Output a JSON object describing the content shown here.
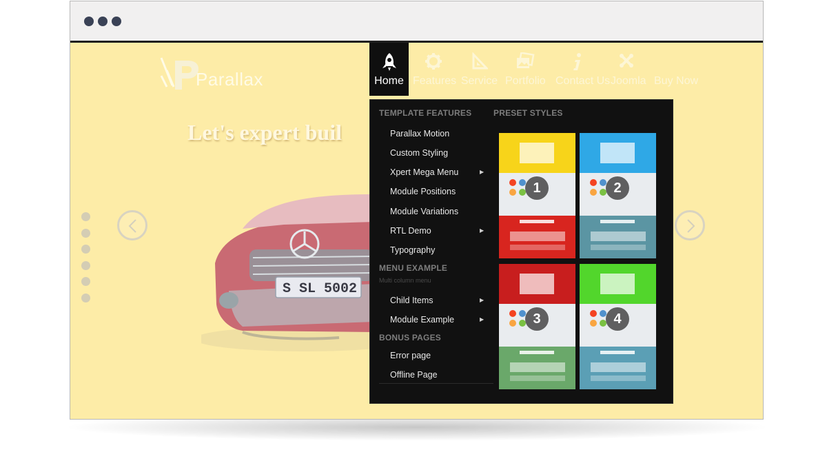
{
  "window": {
    "controls": [
      "dot",
      "dot",
      "dot"
    ]
  },
  "site": {
    "logo_text": "Parallax",
    "hero_headline": "Let's expert buil"
  },
  "nav": [
    {
      "label": "Home",
      "icon": "rocket-icon",
      "active": true
    },
    {
      "label": "Features",
      "icon": "gear-icon",
      "active": false
    },
    {
      "label": "Service",
      "icon": "set-square-icon",
      "active": false
    },
    {
      "label": "Portfolio",
      "icon": "photos-icon",
      "active": false
    },
    {
      "label": "Contact Us",
      "icon": "info-icon",
      "active": false
    },
    {
      "label": "Joomla",
      "icon": "joomla-icon",
      "active": false
    },
    {
      "label": "Buy Now",
      "icon": "",
      "active": false
    }
  ],
  "mega_menu": {
    "template_features": {
      "title": "TEMPLATE FEATURES",
      "items": [
        {
          "label": "Parallax Motion",
          "has_sub": false
        },
        {
          "label": "Custom Styling",
          "has_sub": false
        },
        {
          "label": "Xpert Mega Menu",
          "has_sub": true
        },
        {
          "label": "Module Positions",
          "has_sub": false
        },
        {
          "label": "Module Variations",
          "has_sub": false
        },
        {
          "label": "RTL Demo",
          "has_sub": true
        },
        {
          "label": "Typography",
          "has_sub": false
        }
      ]
    },
    "menu_example": {
      "title": "MENU EXAMPLE",
      "subtitle": "Multi column menu",
      "items": [
        {
          "label": "Child Items",
          "has_sub": true
        },
        {
          "label": "Module Example",
          "has_sub": true
        }
      ]
    },
    "bonus_pages": {
      "title": "BONUS PAGES",
      "items": [
        {
          "label": "Error page"
        },
        {
          "label": "Offline Page"
        }
      ]
    },
    "preset_styles": {
      "title": "PRESET STYLES",
      "presets": [
        {
          "number": "1",
          "top_color": "#f7d41a",
          "bottom_color": "#d8251f"
        },
        {
          "number": "2",
          "top_color": "#2fa8e6",
          "bottom_color": "#5b95a3"
        },
        {
          "number": "3",
          "top_color": "#c81e1e",
          "bottom_color": "#6aa86a"
        },
        {
          "number": "4",
          "top_color": "#52d62c",
          "bottom_color": "#5b9fb5"
        }
      ]
    }
  },
  "slider": {
    "prev_icon": "chevron-left-icon",
    "next_icon": "chevron-right-icon",
    "dots_count": 6,
    "plate_text": "S SL 5002"
  },
  "colors": {
    "page_bg": "#fdeca7",
    "menu_bg": "#111111",
    "nav_text": "#fdf6d6"
  }
}
